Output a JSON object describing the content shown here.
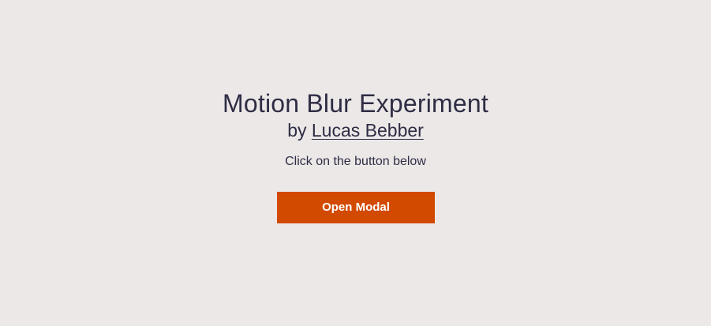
{
  "colors": {
    "background": "#ece8e7",
    "text": "#2e2d44",
    "accent": "#d24a00",
    "button_text": "#ffffff"
  },
  "header": {
    "title": "Motion Blur Experiment",
    "byline_prefix": "by",
    "author_link": "Lucas Bebber"
  },
  "main": {
    "instruction": "Click on the button below",
    "open_button_label": "Open Modal"
  }
}
